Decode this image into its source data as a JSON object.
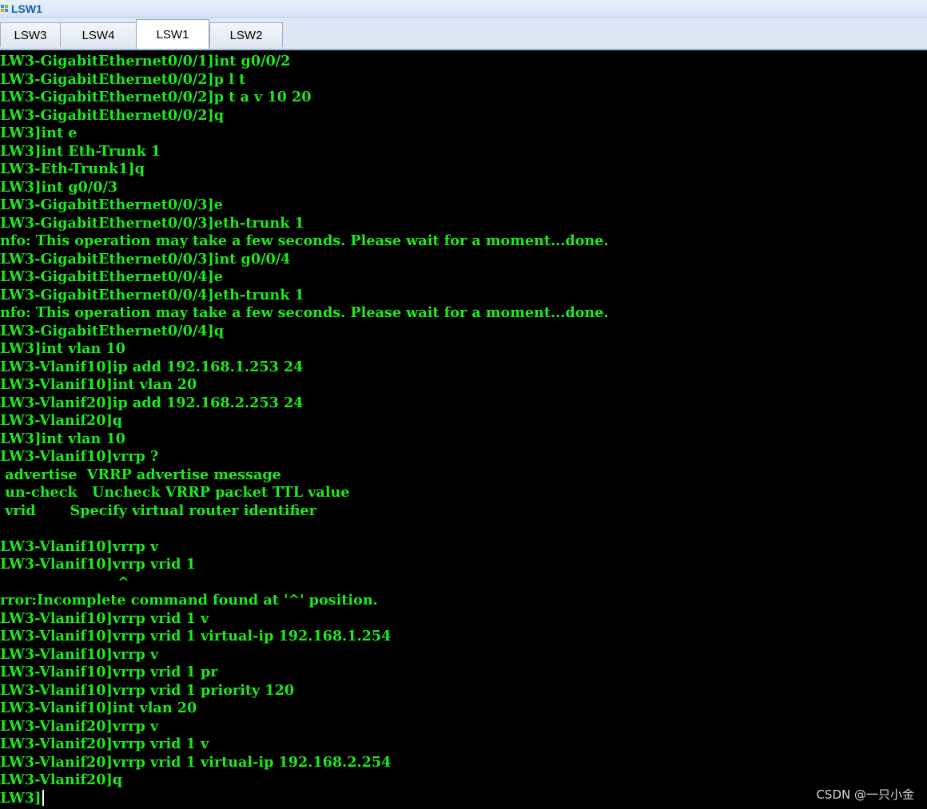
{
  "window": {
    "title": "LSW1"
  },
  "tabs": [
    {
      "label": "LSW3",
      "active": false
    },
    {
      "label": "LSW4",
      "active": false
    },
    {
      "label": "LSW1",
      "active": true
    },
    {
      "label": "LSW2",
      "active": false
    }
  ],
  "terminal": {
    "text_color": "#1ee81e",
    "background_color": "#000000",
    "lines": [
      "LW3-GigabitEthernet0/0/1]int g0/0/2",
      "LW3-GigabitEthernet0/0/2]p l t",
      "LW3-GigabitEthernet0/0/2]p t a v 10 20",
      "LW3-GigabitEthernet0/0/2]q",
      "LW3]int e",
      "LW3]int Eth-Trunk 1",
      "LW3-Eth-Trunk1]q",
      "LW3]int g0/0/3",
      "LW3-GigabitEthernet0/0/3]e",
      "LW3-GigabitEthernet0/0/3]eth-trunk 1",
      "nfo: This operation may take a few seconds. Please wait for a moment...done.",
      "LW3-GigabitEthernet0/0/3]int g0/0/4",
      "LW3-GigabitEthernet0/0/4]e",
      "LW3-GigabitEthernet0/0/4]eth-trunk 1",
      "nfo: This operation may take a few seconds. Please wait for a moment...done.",
      "LW3-GigabitEthernet0/0/4]q",
      "LW3]int vlan 10",
      "LW3-Vlanif10]ip add 192.168.1.253 24",
      "LW3-Vlanif10]int vlan 20",
      "LW3-Vlanif20]ip add 192.168.2.253 24",
      "LW3-Vlanif20]q",
      "LW3]int vlan 10",
      "LW3-Vlanif10]vrrp ?",
      " advertise  VRRP advertise message",
      " un-check   Uncheck VRRP packet TTL value",
      " vrid       Specify virtual router identifier",
      "",
      "LW3-Vlanif10]vrrp v",
      "LW3-Vlanif10]vrrp vrid 1",
      "                        ^",
      "rror:Incomplete command found at '^' position.",
      "LW3-Vlanif10]vrrp vrid 1 v",
      "LW3-Vlanif10]vrrp vrid 1 virtual-ip 192.168.1.254",
      "LW3-Vlanif10]vrrp v",
      "LW3-Vlanif10]vrrp vrid 1 pr",
      "LW3-Vlanif10]vrrp vrid 1 priority 120",
      "LW3-Vlanif10]int vlan 20",
      "LW3-Vlanif20]vrrp v",
      "LW3-Vlanif20]vrrp vrid 1 v",
      "LW3-Vlanif20]vrrp vrid 1 virtual-ip 192.168.2.254",
      "LW3-Vlanif20]q",
      "LW3]"
    ]
  },
  "watermark": "CSDN @一只小金"
}
